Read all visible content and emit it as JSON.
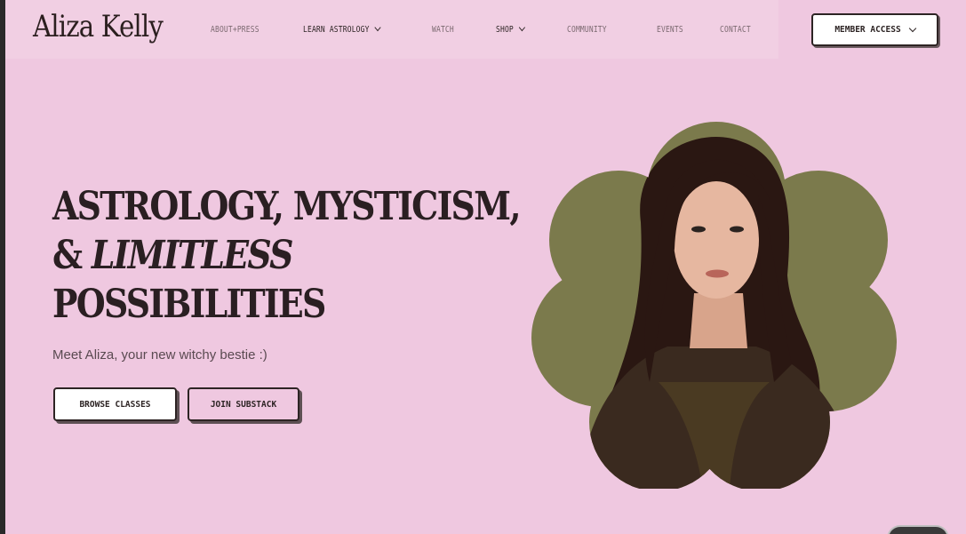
{
  "site": {
    "logo": "Aliza Kelly"
  },
  "nav": {
    "items": [
      {
        "label": "About+Press"
      },
      {
        "label": "Learn Astrology"
      },
      {
        "label": "Watch"
      },
      {
        "label": "Shop"
      },
      {
        "label": "Community"
      },
      {
        "label": "Events"
      },
      {
        "label": "Contact"
      }
    ],
    "member_label": "Member Access"
  },
  "hero": {
    "line1": "ASTROLOGY, MYSTICISM,",
    "line2_prefix": "&",
    "line2_italic": "LIMITLESS",
    "line3": "POSSIBILITIES",
    "subtitle": "Meet Aliza, your new witchy bestie :)",
    "buttons": {
      "browse": "Browse Classes",
      "substack": "Join Substack"
    }
  },
  "colors": {
    "background": "#efc8e0",
    "flower": "#7b7a4c",
    "text_dark": "#2a1f22"
  }
}
